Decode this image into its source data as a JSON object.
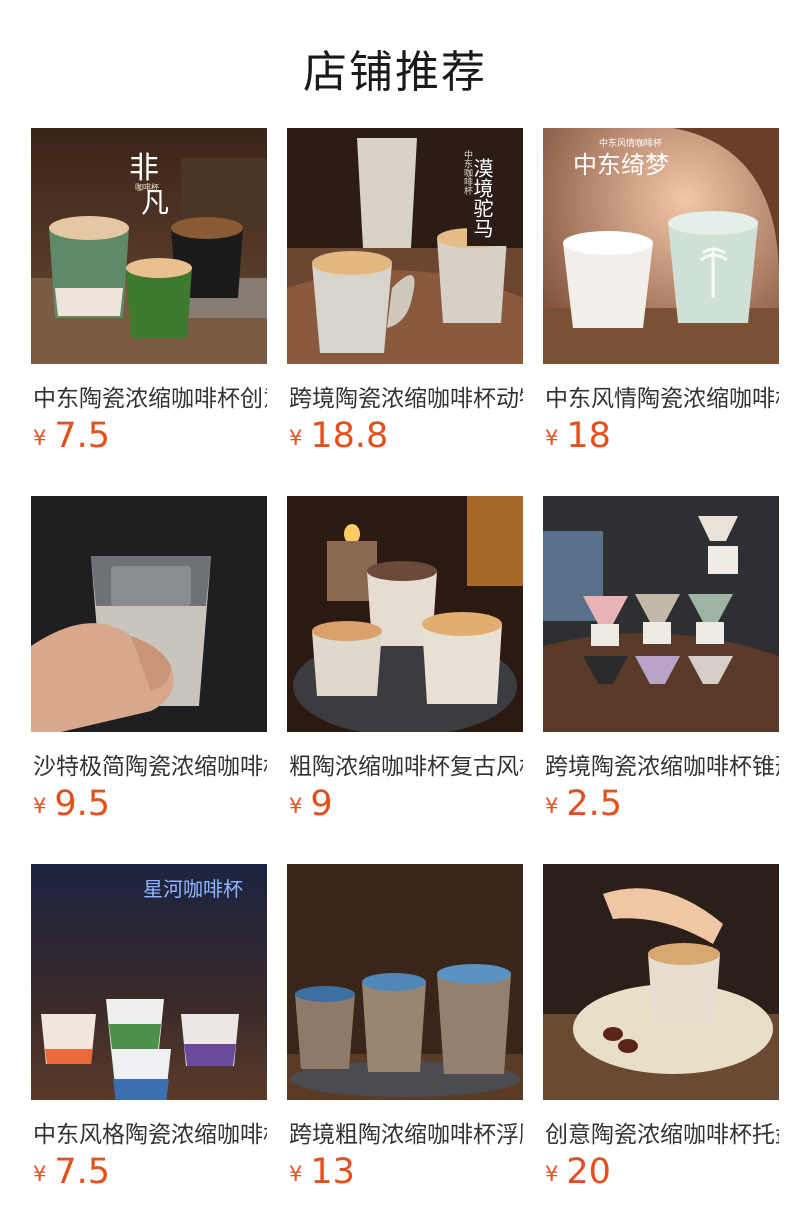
{
  "header": {
    "title": "店铺推荐"
  },
  "currency": "¥",
  "products": [
    {
      "name": "中东陶瓷浓缩咖啡杯创意",
      "price": "7.5",
      "image_text": [
        "非",
        "凡",
        "咖啡杯"
      ]
    },
    {
      "name": "跨境陶瓷浓缩咖啡杯动物",
      "price": "18.8",
      "image_text": [
        "漠境驼马",
        "中东咖啡杯"
      ]
    },
    {
      "name": "中东风情陶瓷浓缩咖啡杯",
      "price": "18",
      "image_text": [
        "中东绮梦",
        "中东风情咖啡杯"
      ]
    },
    {
      "name": "沙特极简陶瓷浓缩咖啡杯",
      "price": "9.5",
      "image_text": []
    },
    {
      "name": "粗陶浓缩咖啡杯复古风格",
      "price": "9",
      "image_text": []
    },
    {
      "name": "跨境陶瓷浓缩咖啡杯锥形",
      "price": "2.5",
      "image_text": []
    },
    {
      "name": "中东风格陶瓷浓缩咖啡杯",
      "price": "7.5",
      "image_text": [
        "星河咖啡杯"
      ]
    },
    {
      "name": "跨境粗陶浓缩咖啡杯浮雕",
      "price": "13",
      "image_text": []
    },
    {
      "name": "创意陶瓷浓缩咖啡杯托盘",
      "price": "20",
      "image_text": []
    }
  ]
}
